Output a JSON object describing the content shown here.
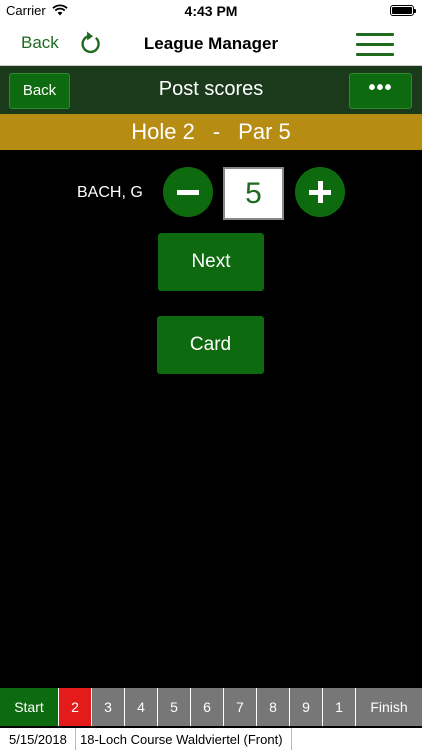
{
  "status_bar": {
    "carrier": "Carrier",
    "time": "4:43 PM"
  },
  "nav": {
    "back_label": "Back",
    "title": "League Manager"
  },
  "header": {
    "back_label": "Back",
    "title": "Post scores",
    "more_label": "•••"
  },
  "hole": {
    "hole_label": "Hole 2",
    "separator": "-",
    "par_label": "Par 5"
  },
  "player": {
    "name": "BACH, G",
    "score": "5"
  },
  "buttons": {
    "next": "Next",
    "card": "Card"
  },
  "hole_tabs": [
    {
      "label": "Start",
      "state": "green"
    },
    {
      "label": "2",
      "state": "red"
    },
    {
      "label": "3",
      "state": "gray"
    },
    {
      "label": "4",
      "state": "gray"
    },
    {
      "label": "5",
      "state": "gray"
    },
    {
      "label": "6",
      "state": "gray"
    },
    {
      "label": "7",
      "state": "gray"
    },
    {
      "label": "8",
      "state": "gray"
    },
    {
      "label": "9",
      "state": "gray"
    },
    {
      "label": "1",
      "state": "gray"
    },
    {
      "label": "Finish",
      "state": "gray"
    }
  ],
  "footer": {
    "date": "5/15/2018",
    "course": "18-Loch Course Waldviertel (Front)"
  },
  "colors": {
    "accent_green": "#0e6a0e",
    "header_dark": "#1b3a1b",
    "hole_bar": "#b68c12",
    "current_tab": "#e31b1b",
    "tab_gray": "#777777"
  }
}
